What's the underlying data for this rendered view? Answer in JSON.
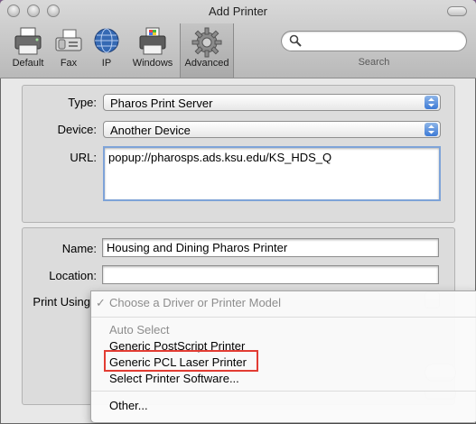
{
  "window": {
    "title": "Add Printer"
  },
  "toolbar": {
    "items": [
      {
        "label": "Default",
        "icon": "printer-icon"
      },
      {
        "label": "Fax",
        "icon": "fax-icon"
      },
      {
        "label": "IP",
        "icon": "globe-icon"
      },
      {
        "label": "Windows",
        "icon": "windows-printer-icon"
      },
      {
        "label": "Advanced",
        "icon": "gear-icon",
        "selected": true
      }
    ],
    "search_label": "Search"
  },
  "form": {
    "type_label": "Type:",
    "type_value": "Pharos Print Server",
    "device_label": "Device:",
    "device_value": "Another Device",
    "url_label": "URL:",
    "url_value": "popup://pharosps.ads.ksu.edu/KS_HDS_Q",
    "name_label": "Name:",
    "name_value": "Housing and Dining Pharos Printer",
    "location_label": "Location:",
    "location_value": "",
    "print_using_label": "Print Using"
  },
  "menu": {
    "selected": "Choose a Driver or Printer Model",
    "check": "✓",
    "items": [
      {
        "label": "Auto Select",
        "disabled": true
      },
      {
        "label": "Generic PostScript Printer"
      },
      {
        "label": "Generic PCL Laser Printer",
        "highlighted": true
      },
      {
        "label": "Select Printer Software..."
      },
      {
        "label": "Other..."
      }
    ]
  },
  "colors": {
    "highlight_box": "#e23c33",
    "popup_arrow": "#3d7ad6"
  }
}
